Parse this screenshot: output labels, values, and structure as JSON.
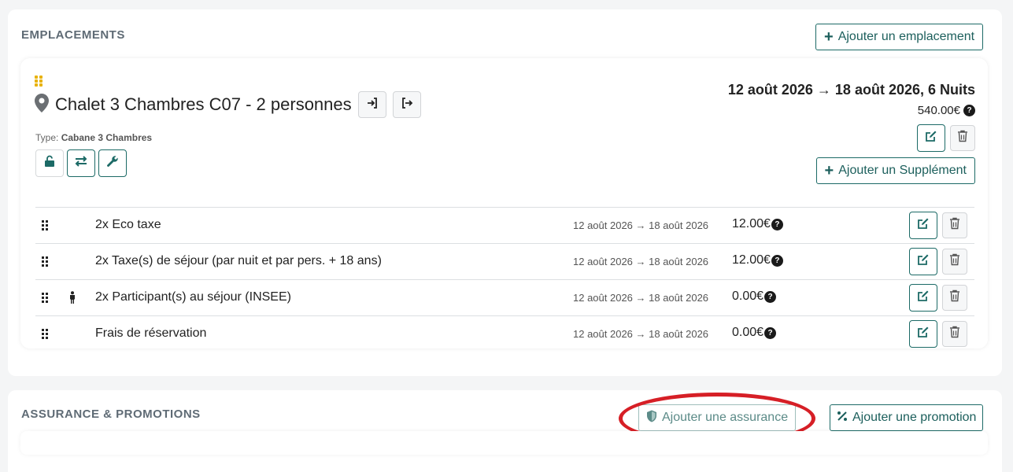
{
  "emplacements": {
    "section_title": "EMPLACEMENTS",
    "add_button_label": "Ajouter un emplacement",
    "location": {
      "title": "Chalet 3 Chambres C07 - 2 personnes",
      "type_prefix": "Type:",
      "type_value": "Cabane 3 Chambres",
      "dates": "12 août 2026 → 18 août 2026, 6 Nuits",
      "price": "540.00€",
      "add_supplement_label": "Ajouter un Supplément"
    },
    "supplements": [
      {
        "label": "2x Eco taxe",
        "dates": "12 août 2026 → 18 août 2026",
        "amount": "12.00€",
        "has_person_icon": false
      },
      {
        "label": "2x Taxe(s) de séjour (par nuit et par pers. + 18 ans)",
        "dates": "12 août 2026 → 18 août 2026",
        "amount": "12.00€",
        "has_person_icon": false
      },
      {
        "label": "2x Participant(s) au séjour (INSEE)",
        "dates": "12 août 2026 → 18 août 2026",
        "amount": "0.00€",
        "has_person_icon": true
      },
      {
        "label": "Frais de réservation",
        "dates": "12 août 2026 → 18 août 2026",
        "amount": "0.00€",
        "has_person_icon": false
      }
    ]
  },
  "assurance": {
    "section_title": "ASSURANCE & PROMOTIONS",
    "add_insurance_label": "Ajouter une assurance",
    "add_promotion_label": "Ajouter une promotion"
  },
  "colors": {
    "accent": "#1c6a66",
    "grip_yellow": "#e8b100",
    "highlight": "#d61f26"
  }
}
